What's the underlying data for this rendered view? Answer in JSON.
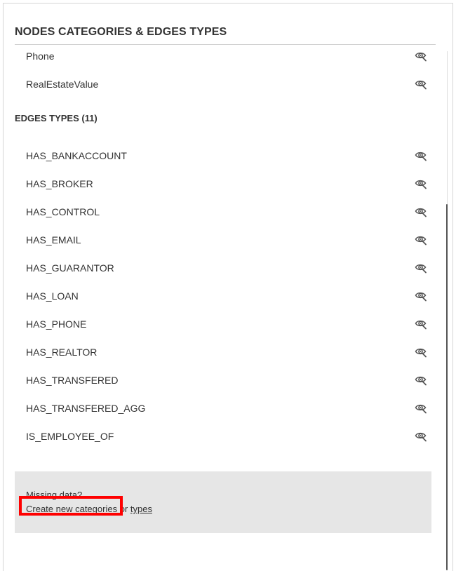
{
  "panel": {
    "title": "NODES CATEGORIES & EDGES TYPES"
  },
  "node_categories": [
    {
      "label": "Phone",
      "icon": "eye-icon"
    },
    {
      "label": "RealEstateValue",
      "icon": "eye-icon"
    }
  ],
  "edges_section": {
    "heading": "EDGES TYPES (11)"
  },
  "edge_types": [
    {
      "label": "HAS_BANKACCOUNT",
      "icon": "eye-icon"
    },
    {
      "label": "HAS_BROKER",
      "icon": "eye-icon"
    },
    {
      "label": "HAS_CONTROL",
      "icon": "eye-icon"
    },
    {
      "label": "HAS_EMAIL",
      "icon": "eye-icon"
    },
    {
      "label": "HAS_GUARANTOR",
      "icon": "eye-icon"
    },
    {
      "label": "HAS_LOAN",
      "icon": "eye-icon"
    },
    {
      "label": "HAS_PHONE",
      "icon": "eye-icon"
    },
    {
      "label": "HAS_REALTOR",
      "icon": "eye-icon"
    },
    {
      "label": "HAS_TRANSFERED",
      "icon": "eye-icon"
    },
    {
      "label": "HAS_TRANSFERED_AGG",
      "icon": "eye-icon"
    },
    {
      "label": "IS_EMPLOYEE_OF",
      "icon": "eye-icon"
    }
  ],
  "missing_data": {
    "question": "Missing data?",
    "prefix": "Create new ",
    "categories_link": "categories",
    "connector": " or ",
    "types_link": "types"
  },
  "colors": {
    "highlight": "#ff0000",
    "footer_background": "#e6e6e6",
    "text": "#333333"
  }
}
